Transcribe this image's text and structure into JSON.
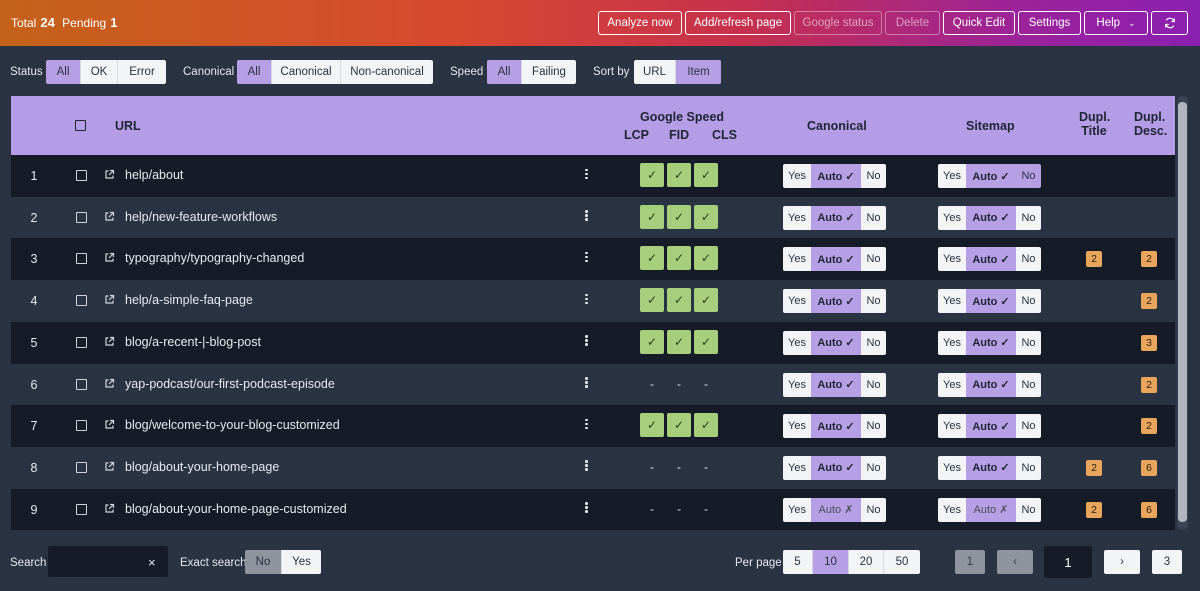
{
  "stats": {
    "total_label": "Total",
    "total": "24",
    "pending_label": "Pending",
    "pending": "1"
  },
  "toolbar": {
    "analyze": "Analyze now",
    "add_refresh": "Add/refresh page",
    "google_status": "Google status",
    "delete": "Delete",
    "quick_edit": "Quick Edit",
    "settings": "Settings",
    "help": "Help",
    "refresh_icon": "refresh-icon"
  },
  "filters": {
    "status": {
      "label": "Status",
      "options": [
        "All",
        "OK",
        "Error"
      ],
      "selected": "All"
    },
    "canonical": {
      "label": "Canonical",
      "options": [
        "All",
        "Canonical",
        "Non-canonical"
      ],
      "selected": "All"
    },
    "speed": {
      "label": "Speed",
      "options": [
        "All",
        "Failing"
      ],
      "selected": "All"
    },
    "sort": {
      "label": "Sort by",
      "options": [
        "URL",
        "Item"
      ],
      "selected": "Item"
    }
  },
  "table": {
    "headers": {
      "url": "URL",
      "google_speed": "Google Speed",
      "lcp": "LCP",
      "fid": "FID",
      "cls": "CLS",
      "canonical": "Canonical",
      "sitemap": "Sitemap",
      "dupl_title_1": "Dupl.",
      "dupl_title_2": "Title",
      "dupl_desc_1": "Dupl.",
      "dupl_desc_2": "Desc."
    },
    "toggle_labels": {
      "yes": "Yes",
      "auto_on": "Auto ✓",
      "auto_off": "Auto ✗",
      "no": "No"
    },
    "speed_pass": "✓",
    "speed_none": "-",
    "rows": [
      {
        "num": "1",
        "url": "help/about",
        "speed": true,
        "canonical_auto": true,
        "sitemap_auto": true,
        "sitemap_no_hl": true,
        "dupl_title": "",
        "dupl_desc": ""
      },
      {
        "num": "2",
        "url": "help/new-feature-workflows",
        "speed": true,
        "canonical_auto": true,
        "sitemap_auto": true,
        "sitemap_no_hl": false,
        "dupl_title": "",
        "dupl_desc": ""
      },
      {
        "num": "3",
        "url": "typography/typography-changed",
        "speed": true,
        "canonical_auto": true,
        "sitemap_auto": true,
        "sitemap_no_hl": false,
        "dupl_title": "2",
        "dupl_desc": "2"
      },
      {
        "num": "4",
        "url": "help/a-simple-faq-page",
        "speed": true,
        "canonical_auto": true,
        "sitemap_auto": true,
        "sitemap_no_hl": false,
        "dupl_title": "",
        "dupl_desc": "2"
      },
      {
        "num": "5",
        "url": "blog/a-recent-|-blog-post",
        "speed": true,
        "canonical_auto": true,
        "sitemap_auto": true,
        "sitemap_no_hl": false,
        "dupl_title": "",
        "dupl_desc": "3"
      },
      {
        "num": "6",
        "url": "yap-podcast/our-first-podcast-episode",
        "speed": false,
        "canonical_auto": true,
        "sitemap_auto": true,
        "sitemap_no_hl": false,
        "dupl_title": "",
        "dupl_desc": "2"
      },
      {
        "num": "7",
        "url": "blog/welcome-to-your-blog-customized",
        "speed": true,
        "canonical_auto": true,
        "sitemap_auto": true,
        "sitemap_no_hl": false,
        "dupl_title": "",
        "dupl_desc": "2"
      },
      {
        "num": "8",
        "url": "blog/about-your-home-page",
        "speed": false,
        "canonical_auto": true,
        "sitemap_auto": true,
        "sitemap_no_hl": false,
        "dupl_title": "2",
        "dupl_desc": "6"
      },
      {
        "num": "9",
        "url": "blog/about-your-home-page-customized",
        "speed": false,
        "canonical_auto": false,
        "sitemap_auto": false,
        "sitemap_no_hl": false,
        "dupl_title": "2",
        "dupl_desc": "6"
      }
    ]
  },
  "footer": {
    "search_label": "Search",
    "search_value": "",
    "clear_icon": "×",
    "exact_label": "Exact search",
    "exact_options": [
      "No",
      "Yes"
    ],
    "exact_selected": "No",
    "per_page_label": "Per page",
    "per_page_options": [
      "5",
      "10",
      "20",
      "50"
    ],
    "per_page_selected": "10",
    "pagination": {
      "first": "1",
      "prev": "‹",
      "current": "1",
      "next": "›",
      "last": "3"
    }
  },
  "colors": {
    "accent": "#b79fe6",
    "pass": "#a6ce7c",
    "badge": "#e9a55b"
  }
}
